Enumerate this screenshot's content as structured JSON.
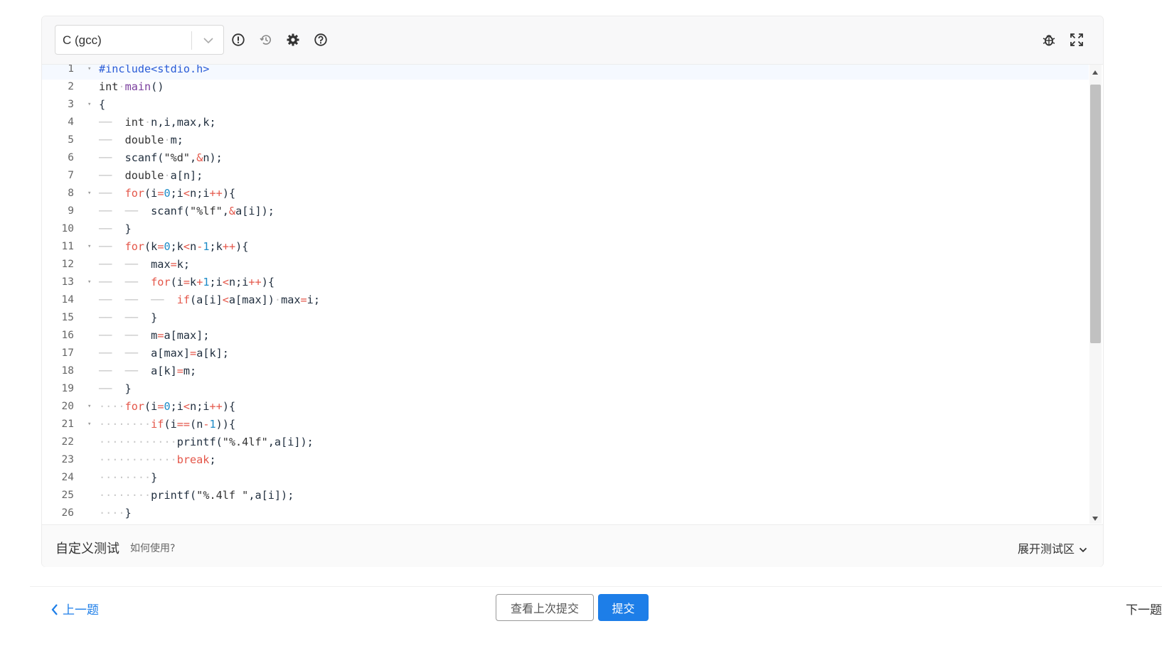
{
  "toolbar": {
    "language": "C (gcc)",
    "icons": [
      "info-icon",
      "history-icon",
      "gear-icon",
      "help-icon",
      "debug-icon",
      "fullscreen-icon"
    ]
  },
  "code_lines": [
    "#include<stdio.h>",
    "int main()",
    "{",
    "    int n,i,max,k;",
    "    double m;",
    "    scanf(\"%d\",&n);",
    "    double a[n];",
    "    for(i=0;i<n;i++){",
    "        scanf(\"%lf\",&a[i]);",
    "    }",
    "    for(k=0;k<n-1;k++){",
    "        max=k;",
    "        for(i=k+1;i<n;i++){",
    "            if(a[i]<a[max]) max=i;",
    "        }",
    "        m=a[max];",
    "        a[max]=a[k];",
    "        a[k]=m;",
    "    }",
    "    for(i=0;i<n;i++){",
    "        if(i==(n-1)){",
    "            printf(\"%.4lf\",a[i]);",
    "            break;",
    "        }",
    "        printf(\"%.4lf \",a[i]);",
    "    }"
  ],
  "custom_test": {
    "title": "自定义测试",
    "help": "如何使用?",
    "expand": "展开测试区"
  },
  "nav": {
    "prev": "上一题",
    "view_last": "查看上次提交",
    "submit": "提交",
    "next": "下一题"
  },
  "colors": {
    "accent": "#1d7ee8",
    "keyword": "#e45649",
    "number": "#1d8bc7",
    "function": "#7a3e9d"
  }
}
